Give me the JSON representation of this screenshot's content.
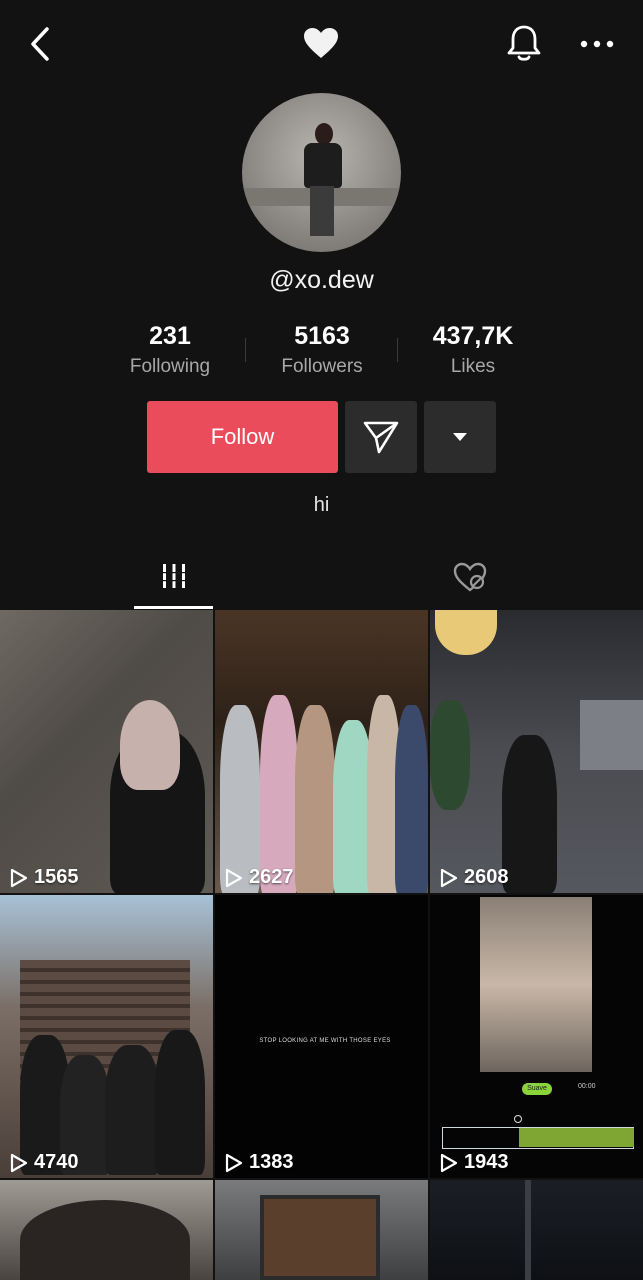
{
  "profile": {
    "username": "@xo.dew",
    "bio": "hi"
  },
  "stats": [
    {
      "value": "231",
      "label": "Following"
    },
    {
      "value": "5163",
      "label": "Followers"
    },
    {
      "value": "437,7K",
      "label": "Likes"
    }
  ],
  "actions": {
    "follow_label": "Follow"
  },
  "tabs": [
    {
      "icon": "grid-icon",
      "active": true
    },
    {
      "icon": "liked-hidden-icon",
      "active": false
    }
  ],
  "videos": [
    {
      "plays": "1565"
    },
    {
      "plays": "2627"
    },
    {
      "plays": "2608"
    },
    {
      "plays": "4740"
    },
    {
      "plays": "1383",
      "caption": "STOP LOOKING AT ME WITH THOSE EYES"
    },
    {
      "plays": "1943",
      "sticker": "Suave",
      "timer": "00:00"
    },
    {
      "plays": ""
    },
    {
      "plays": ""
    },
    {
      "plays": ""
    }
  ],
  "colors": {
    "background": "#121212",
    "follow_button": "#ea4c5c",
    "secondary_button": "#2c2c2c"
  }
}
